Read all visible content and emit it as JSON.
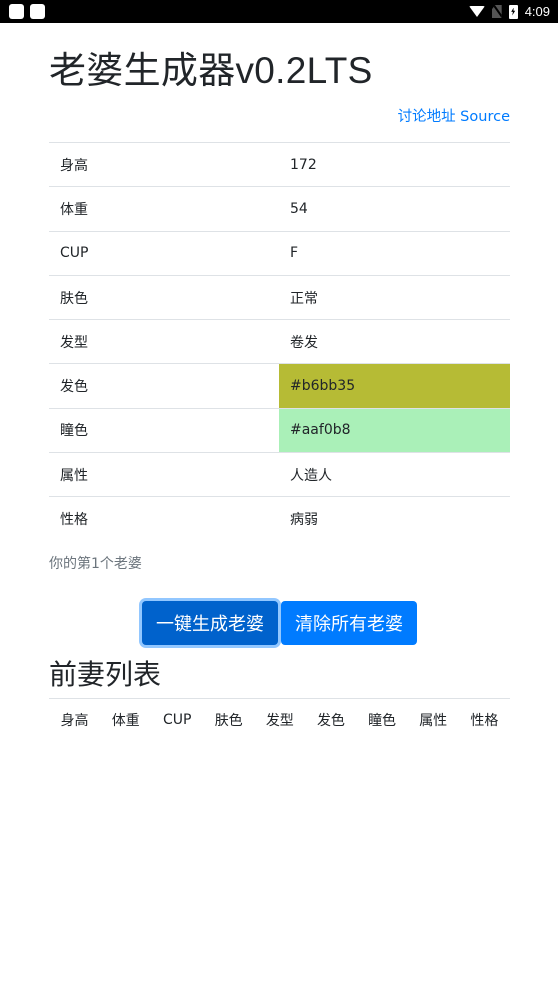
{
  "statusbar": {
    "time": "4:09",
    "icons": [
      "app-notification-icon",
      "app-notification-icon",
      "wifi-icon",
      "no-sim-icon",
      "battery-charging-icon"
    ]
  },
  "header": {
    "title": "老婆生成器v0.2LTS",
    "source_link": "讨论地址 Source"
  },
  "wife": {
    "rows": [
      {
        "key": "身高",
        "value": "172"
      },
      {
        "key": "体重",
        "value": "54"
      },
      {
        "key": "CUP",
        "value": "F"
      },
      {
        "key": "肤色",
        "value": "正常"
      },
      {
        "key": "发型",
        "value": "卷发"
      },
      {
        "key": "发色",
        "value": "#b6bb35",
        "color": "#b6bb35"
      },
      {
        "key": "瞳色",
        "value": "#aaf0b8",
        "color": "#aaf0b8"
      },
      {
        "key": "属性",
        "value": "人造人"
      },
      {
        "key": "性格",
        "value": "病弱"
      }
    ],
    "count_text": "你的第1个老婆"
  },
  "actions": {
    "generate_label": "一键生成老婆",
    "clear_label": "清除所有老婆"
  },
  "history": {
    "title": "前妻列表",
    "columns": [
      "身高",
      "体重",
      "CUP",
      "肤色",
      "发型",
      "发色",
      "瞳色",
      "属性",
      "性格"
    ]
  }
}
